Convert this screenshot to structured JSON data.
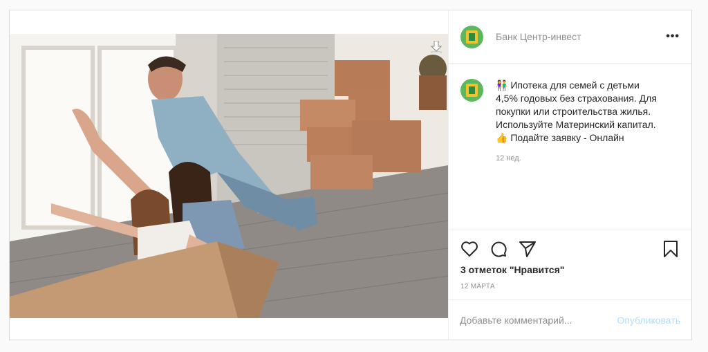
{
  "post": {
    "username": "Банк Центр-инвест",
    "more_icon": "more-horizontal-icon",
    "caption_lines": [
      "Ипотека для семей с детьми",
      "4,5% годовых без страхования. Для",
      "покупки или строительства жилья.",
      "Используйте Материнский капитал.",
      "Подайте заявку - Онлайн"
    ],
    "caption_emoji_1": "👫",
    "caption_emoji_2": "👍",
    "time_ago": "12 нед.",
    "likes": "3 отметок \"Нравится\"",
    "date": "12 МАРТА"
  },
  "actions": {
    "like_icon": "heart-icon",
    "comment_icon": "comment-icon",
    "share_icon": "paper-plane-icon",
    "save_icon": "bookmark-icon"
  },
  "comment": {
    "placeholder": "Добавьте комментарий...",
    "publish_label": "Опубликовать"
  },
  "colors": {
    "avatar_bg": "#5cb85c",
    "publish_disabled": "#b2dffc",
    "muted_text": "#8e8e8e"
  }
}
